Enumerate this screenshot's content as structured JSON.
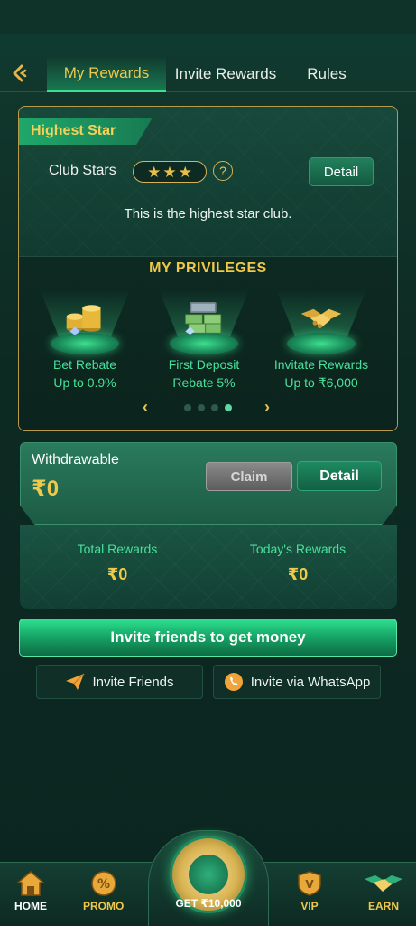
{
  "tabs": {
    "back_icon": "chevron-left-icon",
    "items": [
      {
        "label": "My Rewards",
        "active": true
      },
      {
        "label": "Invite Rewards",
        "active": false
      },
      {
        "label": "Rules",
        "active": false
      }
    ]
  },
  "club": {
    "ribbon": "Highest Star",
    "stars_label": "Club Stars",
    "stars": 3,
    "detail_label": "Detail",
    "message": "This is the highest star club."
  },
  "privileges": {
    "title": "MY PRIVILEGES",
    "items": [
      {
        "line1": "Bet Rebate",
        "line2": "Up to  0.9%",
        "icon": "gold-coins-icon"
      },
      {
        "line1": "First Deposit",
        "line2": "Rebate  5%",
        "icon": "cash-stack-icon"
      },
      {
        "line1": "Invitate Rewards",
        "line2": "Up to  ₹6,000",
        "icon": "handshake-icon"
      }
    ],
    "prev_icon": "‹",
    "next_icon": "›",
    "page_count": 4,
    "current_page": 4
  },
  "withdraw": {
    "label": "Withdrawable",
    "amount": "₹0",
    "claim_label": "Claim",
    "detail_label": "Detail"
  },
  "totals": {
    "total_label": "Total Rewards",
    "total_value": "₹0",
    "today_label": "Today's Rewards",
    "today_value": "₹0"
  },
  "invite": {
    "main_label": "Invite friends to get money",
    "friends_label": "Invite Friends",
    "whatsapp_label": "Invite via WhatsApp"
  },
  "bottom_nav": {
    "home": "HOME",
    "promo": "PROMO",
    "get": "GET ₹10,000",
    "vip": "VIP",
    "earn": "EARN"
  },
  "colors": {
    "accent_gold": "#f0c84a",
    "accent_green": "#49e09a",
    "background": "#0d2a22"
  }
}
